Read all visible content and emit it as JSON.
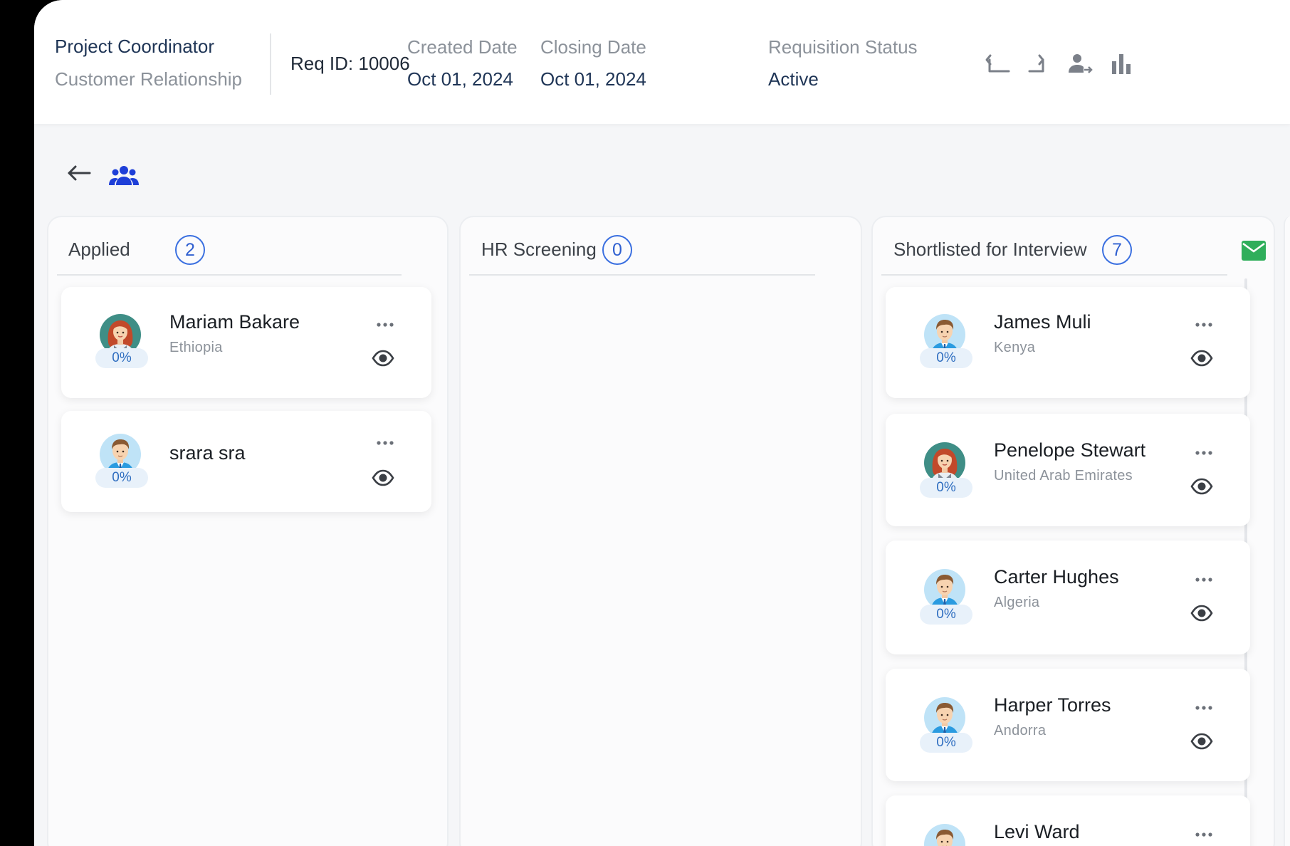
{
  "header": {
    "job_title": "Project Coordinator",
    "department": "Customer Relationship",
    "req_id": "Req ID: 10006",
    "created_label": "Created Date",
    "created_value": "Oct 01, 2024",
    "closing_label": "Closing Date",
    "closing_value": "Oct 01, 2024",
    "status_label": "Requisition Status",
    "status_value": "Active",
    "actions": [
      "turn-up-left-icon",
      "turn-up-right-icon",
      "user-transfer-icon",
      "bar-chart-icon"
    ]
  },
  "toolbar": {
    "icons": [
      "arrow-left-icon",
      "people-group-icon"
    ]
  },
  "colors": {
    "accent_blue": "#1e3fd8",
    "badge_blue": "#3a6fe0",
    "mail_green": "#2fae5b"
  },
  "columns": [
    {
      "title": "Applied",
      "count": "2",
      "candidates": [
        {
          "name": "Mariam Bakare",
          "location": "Ethiopia",
          "match": "0%",
          "avatar": "female-avatar-icon"
        },
        {
          "name": "srara sra",
          "location": "",
          "match": "0%",
          "avatar": "male-avatar-icon"
        }
      ]
    },
    {
      "title": "HR Screening",
      "count": "0",
      "candidates": []
    },
    {
      "title": "Shortlisted for Interview",
      "count": "7",
      "has_mail": true,
      "candidates": [
        {
          "name": "James Muli",
          "location": "Kenya",
          "match": "0%",
          "avatar": "male-avatar-icon"
        },
        {
          "name": "Penelope Stewart",
          "location": "United Arab Emirates",
          "match": "0%",
          "avatar": "female-avatar-icon"
        },
        {
          "name": "Carter Hughes",
          "location": "Algeria",
          "match": "0%",
          "avatar": "male-avatar-icon"
        },
        {
          "name": "Harper Torres",
          "location": "Andorra",
          "match": "0%",
          "avatar": "male-avatar-icon"
        },
        {
          "name": "Levi Ward",
          "location": "",
          "match": "",
          "avatar": "male-avatar-icon"
        }
      ]
    }
  ]
}
